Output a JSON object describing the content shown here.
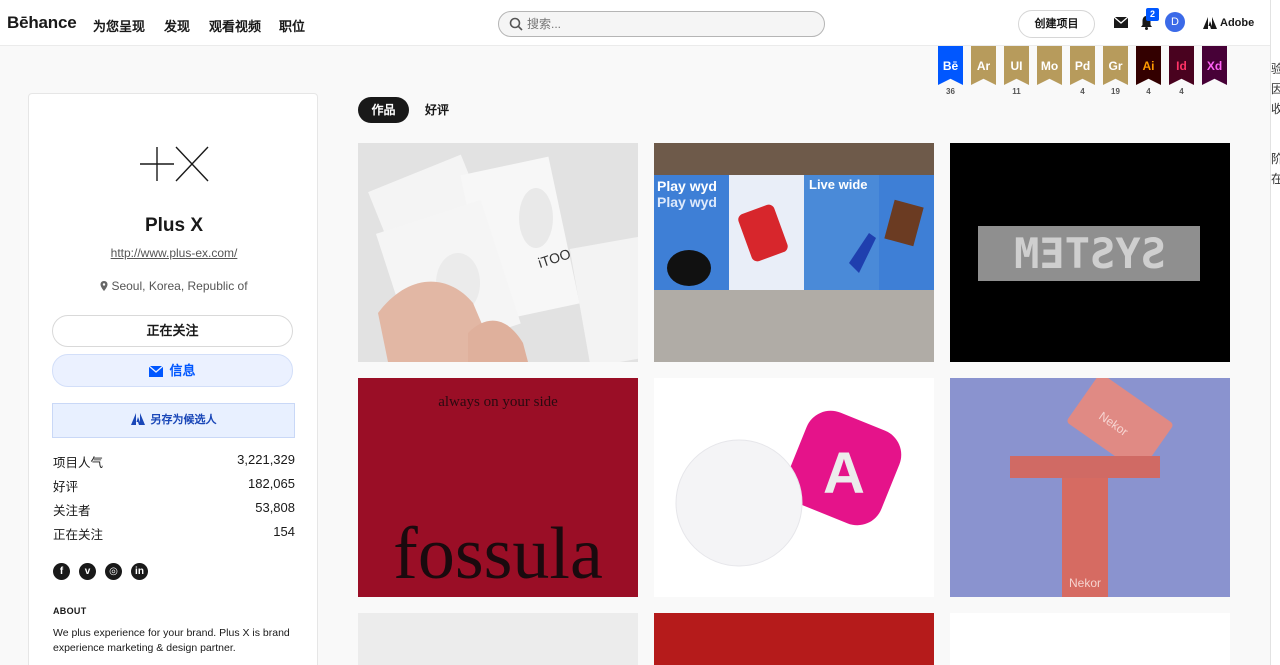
{
  "nav": {
    "logo": "Bēhance",
    "items": [
      "为您呈现",
      "发现",
      "观看视频",
      "职位"
    ],
    "search_placeholder": "搜索...",
    "create_label": "创建项目",
    "notification_count": "2",
    "user_initial": "D",
    "adobe_label": "Adobe"
  },
  "ribbons": [
    {
      "label": "Bē",
      "count": "36",
      "color": "#0057ff",
      "text_color": "#ffffff"
    },
    {
      "label": "Ar",
      "count": "",
      "color": "#b79b5c",
      "text_color": "#ffffff"
    },
    {
      "label": "UI",
      "count": "11",
      "color": "#b79b5c",
      "text_color": "#ffffff"
    },
    {
      "label": "Mo",
      "count": "",
      "color": "#b79b5c",
      "text_color": "#ffffff"
    },
    {
      "label": "Pd",
      "count": "4",
      "color": "#b79b5c",
      "text_color": "#ffffff"
    },
    {
      "label": "Gr",
      "count": "19",
      "color": "#b79b5c",
      "text_color": "#ffffff"
    },
    {
      "label": "Ai",
      "count": "4",
      "color": "#330000",
      "text_color": "#ff9a00"
    },
    {
      "label": "Id",
      "count": "4",
      "color": "#49021f",
      "text_color": "#ff3366"
    },
    {
      "label": "Xd",
      "count": "",
      "color": "#470137",
      "text_color": "#ff61f6"
    }
  ],
  "profile": {
    "name": "Plus X",
    "url": "http://www.plus-ex.com/",
    "location": "Seoul, Korea, Republic of",
    "follow_label": "正在关注",
    "message_label": "信息",
    "save_candidate_label": "另存为候选人",
    "stats": [
      {
        "label": "项目人气",
        "value": "3,221,329"
      },
      {
        "label": "好评",
        "value": "182,065"
      },
      {
        "label": "关注者",
        "value": "53,808"
      },
      {
        "label": "正在关注",
        "value": "154"
      }
    ],
    "social": [
      "f",
      "v",
      "◎",
      "in"
    ],
    "about_heading": "ABOUT",
    "about_text": "We plus experience for your brand. Plus X is brand experience marketing & design partner."
  },
  "tabs": {
    "works": "作品",
    "appreciations": "好评"
  },
  "projects": [
    {
      "name": "itoo",
      "text": "iTOO",
      "bg": "#dcdcdc"
    },
    {
      "name": "play-wyd",
      "text": "Play wyd",
      "text2": "Live wide",
      "bg": "#4a8ad8"
    },
    {
      "name": "system",
      "text": "SYSTEM",
      "bg": "#000000"
    },
    {
      "name": "fossula",
      "text": "fossula",
      "text2": "always on your side",
      "bg": "#9a0e26"
    },
    {
      "name": "a-logo",
      "text": "A",
      "bg": "#ffffff"
    },
    {
      "name": "nekor",
      "text": "Nekor",
      "bg": "#8a93cf"
    }
  ],
  "edge_text": [
    "验",
    "因",
    "收",
    "阶",
    "在"
  ]
}
